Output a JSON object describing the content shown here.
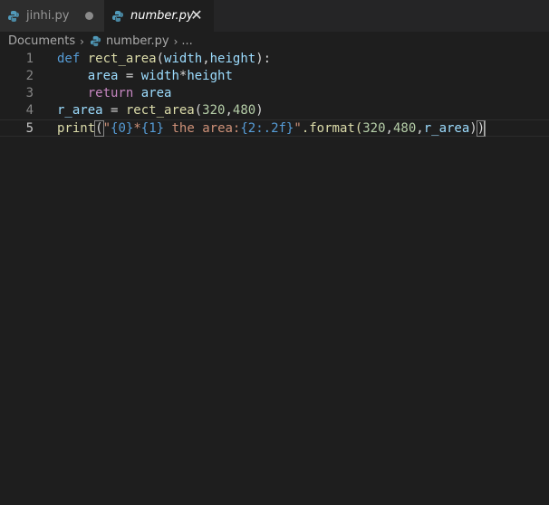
{
  "tabs": [
    {
      "label": "jinhi.py",
      "state": "modified"
    },
    {
      "label": "number.py",
      "state": "active"
    }
  ],
  "breadcrumb": {
    "folder": "Documents",
    "file": "number.py",
    "more": "..."
  },
  "editor": {
    "current_line": 5,
    "line_numbers": [
      "1",
      "2",
      "3",
      "4",
      "5"
    ],
    "lines": [
      [
        "def",
        " ",
        "rect_area",
        "(",
        "width",
        ",",
        "height",
        "):"
      ],
      [
        "    ",
        "area",
        " = ",
        "width",
        "*",
        "height"
      ],
      [
        "    ",
        "return",
        " ",
        "area"
      ],
      [
        "r_area",
        " = ",
        "rect_area",
        "(",
        "320",
        ",",
        "480",
        ")"
      ],
      [
        "print",
        "(",
        "\"",
        "{0}",
        "*",
        "{1}",
        " the area:",
        "{2:.2f}",
        "\"",
        ".format(",
        "320",
        ",",
        "480",
        ",",
        "r_area",
        ")",
        ")"
      ]
    ]
  },
  "colors": {
    "background": "#1e1e1e",
    "keyword": "#569cd6",
    "control_keyword": "#c586c0",
    "function": "#dcdcaa",
    "variable": "#9cdcfe",
    "number": "#b5cea8",
    "string": "#ce9178"
  },
  "icons": {
    "file": "python-file-icon",
    "close": "close-icon",
    "modified": "unsaved-dot-icon",
    "separator": "chevron-right-icon"
  }
}
